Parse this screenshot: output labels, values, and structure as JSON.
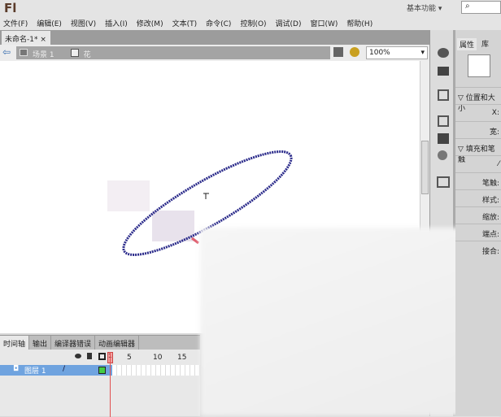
{
  "app": {
    "logo": "Fl",
    "workspace": "基本功能 ▾",
    "search_icon": "⌕"
  },
  "menu": [
    "文件(F)",
    "编辑(E)",
    "视图(V)",
    "插入(I)",
    "修改(M)",
    "文本(T)",
    "命令(C)",
    "控制(O)",
    "调试(D)",
    "窗口(W)",
    "帮助(H)"
  ],
  "document": {
    "tab": "未命名-1*",
    "close": "×",
    "scene": "场景 1",
    "symbol": "花",
    "zoom": "100%"
  },
  "properties": {
    "tabs": [
      "属性",
      "库"
    ],
    "section_position": "位置和大小",
    "x_label": "X:",
    "width_label": "宽:",
    "section_fill": "填充和笔触",
    "rows": [
      "笔触:",
      "样式:",
      "缩放:",
      "端点:",
      "接合:"
    ]
  },
  "timeline": {
    "tabs": [
      "时间轴",
      "输出",
      "编译器错误",
      "动画编辑器"
    ],
    "frames": [
      "1",
      "5",
      "10",
      "15"
    ],
    "layer": "图层 1"
  },
  "colors": {
    "ellipse": "#2a2a8a",
    "layer_selected": "#6fa3df",
    "playhead": "#e05050"
  }
}
